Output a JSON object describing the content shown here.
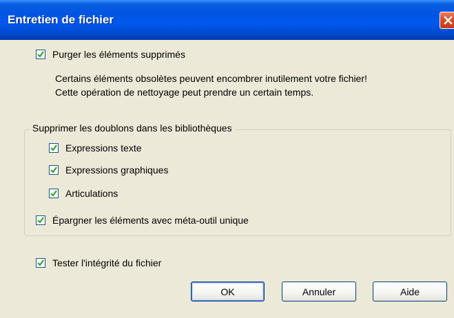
{
  "window": {
    "title": "Entretien de fichier"
  },
  "purge": {
    "label": "Purger les éléments supprimés",
    "checked": true,
    "description_line1": "Certains éléments obsolètes peuvent encombrer inutilement votre fichier!",
    "description_line2": "Cette opération de nettoyage peut prendre un certain temps."
  },
  "duplicates": {
    "legend": "Supprimer les doublons dans les bibliothèques",
    "items": [
      {
        "label": "Expressions texte",
        "checked": true
      },
      {
        "label": "Expressions graphiques",
        "checked": true
      },
      {
        "label": "Articulations",
        "checked": true
      }
    ],
    "spare": {
      "label": "Épargner les éléments avec méta-outil unique",
      "checked": true
    }
  },
  "integrity": {
    "label": "Tester l'intégrité du fichier",
    "checked": true
  },
  "buttons": {
    "ok": "OK",
    "cancel": "Annuler",
    "help": "Aide"
  }
}
